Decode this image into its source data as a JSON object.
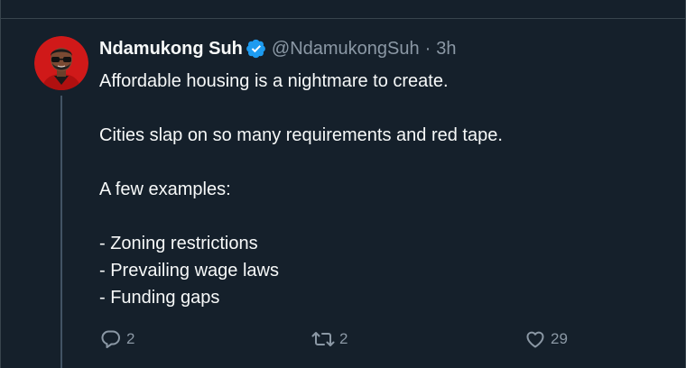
{
  "tweet": {
    "display_name": "Ndamukong Suh",
    "handle": "@NdamukongSuh",
    "separator": "·",
    "time": "3h",
    "lines": [
      "Affordable housing is a nightmare to create.",
      "",
      "Cities slap on so many requirements and red tape.",
      "",
      "A few examples:",
      "",
      "- Zoning restrictions",
      "- Prevailing wage laws",
      "- Funding gaps"
    ]
  },
  "actions": {
    "replies": "2",
    "retweets": "2",
    "likes": "29"
  },
  "icons": {
    "verified": "verified-badge-icon",
    "reply": "reply-icon",
    "retweet": "retweet-icon",
    "like": "heart-icon"
  },
  "colors": {
    "background": "#15202b",
    "text": "#f7f9f9",
    "muted": "#8b98a5",
    "verified": "#1d9bf0",
    "avatar_bg": "#d01919"
  }
}
